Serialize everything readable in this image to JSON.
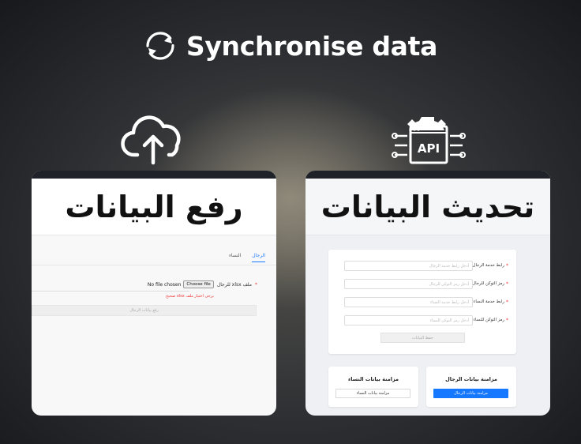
{
  "headline": {
    "text": "Synchronise data",
    "icon": "sync-icon"
  },
  "left_panel": {
    "title": "رفع البيانات",
    "icon": "cloud-upload-icon",
    "tabs": [
      {
        "label": "الرجال",
        "active": true
      },
      {
        "label": "النساء",
        "active": false
      }
    ],
    "file_field": {
      "required_mark": "*",
      "label": "ملف xlsx للرجال",
      "button": "Choose file",
      "status": "No file chosen"
    },
    "error": "يرجى اختيار ملف xlsx صحيح",
    "submit": "رفع بيانات الرجال"
  },
  "right_panel": {
    "title": "تحديث البيانات",
    "icon": "api-gear-icon",
    "api_label": "API",
    "form": {
      "rows": [
        {
          "required_mark": "*",
          "label": "رابط خدمة الرجال:",
          "placeholder": "أدخل رابط خدمة الرجال"
        },
        {
          "required_mark": "*",
          "label": "رمز التوكن للرجال:",
          "placeholder": "أدخل رمز التوكن للرجال"
        },
        {
          "required_mark": "*",
          "label": "رابط خدمة النساء:",
          "placeholder": "أدخل رابط خدمة النساء"
        },
        {
          "required_mark": "*",
          "label": "رمز التوكن للنساء:",
          "placeholder": "أدخل رمز التوكن للنساء"
        }
      ],
      "save": "حفظ البيانات"
    },
    "sync_men": {
      "title": "مزامنة بيانات الرجال",
      "button": "مزامنة بيانات الرجال"
    },
    "sync_women": {
      "title": "مزامنة بيانات النساء",
      "button": "مزامنة بيانات النساء"
    }
  },
  "colors": {
    "primary": "#1677ff",
    "error": "#ee3333",
    "headline": "#ffffff"
  }
}
